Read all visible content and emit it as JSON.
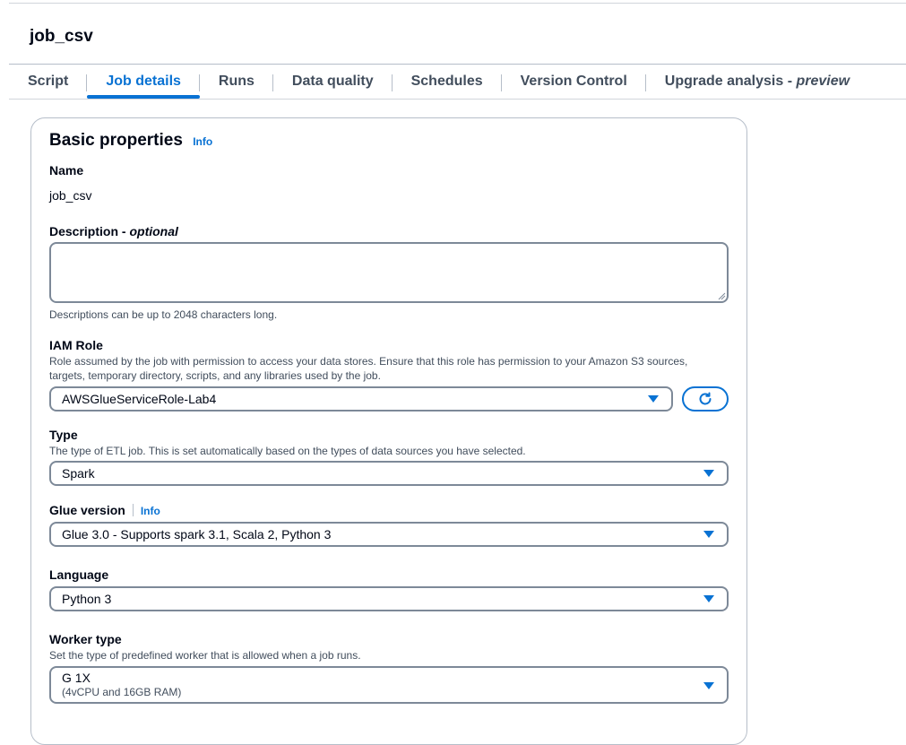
{
  "page": {
    "job_name": "job_csv"
  },
  "tabs": [
    {
      "label": "Script"
    },
    {
      "label": "Job details"
    },
    {
      "label": "Runs"
    },
    {
      "label": "Data quality"
    },
    {
      "label": "Schedules"
    },
    {
      "label": "Version Control"
    },
    {
      "label": "Upgrade analysis - ",
      "suffix": "preview"
    }
  ],
  "active_tab": "Job details",
  "basic": {
    "title": "Basic properties",
    "info": "Info",
    "name_label": "Name",
    "name_value": "job_csv",
    "description_label": "Description - ",
    "description_optional": "optional",
    "description_value": "",
    "description_hint": "Descriptions can be up to 2048 characters long.",
    "iam_label": "IAM Role",
    "iam_hint": "Role assumed by the job with permission to access your data stores. Ensure that this role has permission to your Amazon S3 sources, targets, temporary directory, scripts, and any libraries used by the job.",
    "iam_value": "AWSGlueServiceRole-Lab4",
    "type_label": "Type",
    "type_hint": "The type of ETL job. This is set automatically based on the types of data sources you have selected.",
    "type_value": "Spark",
    "glue_label": "Glue version",
    "glue_info": "Info",
    "glue_value": "Glue 3.0 - Supports spark 3.1, Scala 2, Python 3",
    "language_label": "Language",
    "language_value": "Python 3",
    "worker_label": "Worker type",
    "worker_hint": "Set the type of predefined worker that is allowed when a job runs.",
    "worker_value": "G 1X",
    "worker_sub": "(4vCPU and 16GB RAM)"
  },
  "colors": {
    "accent": "#0972d3",
    "border": "#7d8998",
    "text": "#000716",
    "muted": "#414d5c"
  },
  "icons": {
    "refresh": "refresh-icon",
    "caret": "caret-down-icon"
  }
}
